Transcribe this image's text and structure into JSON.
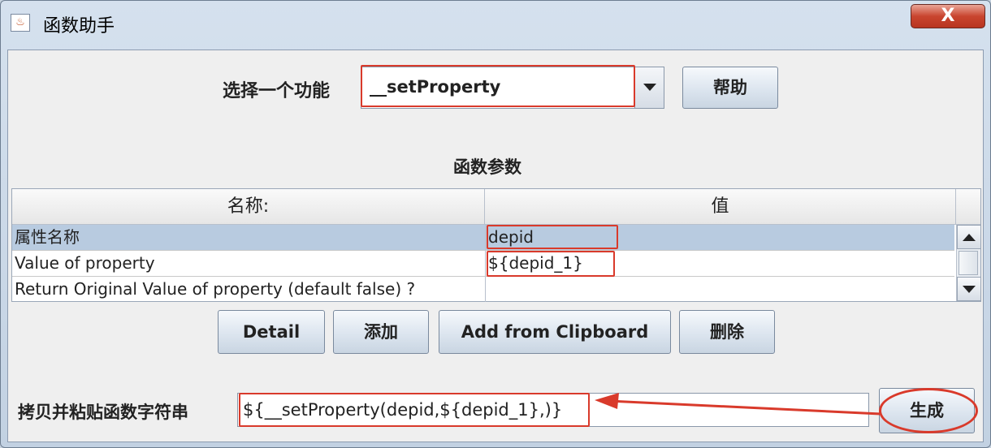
{
  "window": {
    "title": "函数助手",
    "close_label": "X",
    "app_icon": "java-icon"
  },
  "function_select": {
    "label": "选择一个功能",
    "selected": "__setProperty",
    "help_label": "帮助"
  },
  "params": {
    "section_title": "函数参数",
    "columns": [
      "名称:",
      "值"
    ],
    "rows": [
      {
        "name": "属性名称",
        "value": "depid",
        "selected": true
      },
      {
        "name": "Value of property",
        "value": "${depid_1}",
        "selected": false
      },
      {
        "name": "Return Original Value of property (default false) ?",
        "value": "",
        "selected": false
      }
    ]
  },
  "actions": {
    "detail": "Detail",
    "add": "添加",
    "add_clipboard": "Add from Clipboard",
    "delete": "删除"
  },
  "result": {
    "label": "拷贝并粘贴函数字符串",
    "value": "${__setProperty(depid,${depid_1},)}",
    "generate_label": "生成"
  },
  "colors": {
    "highlight": "#d93a2b",
    "selected_row": "#b8cbe0"
  }
}
